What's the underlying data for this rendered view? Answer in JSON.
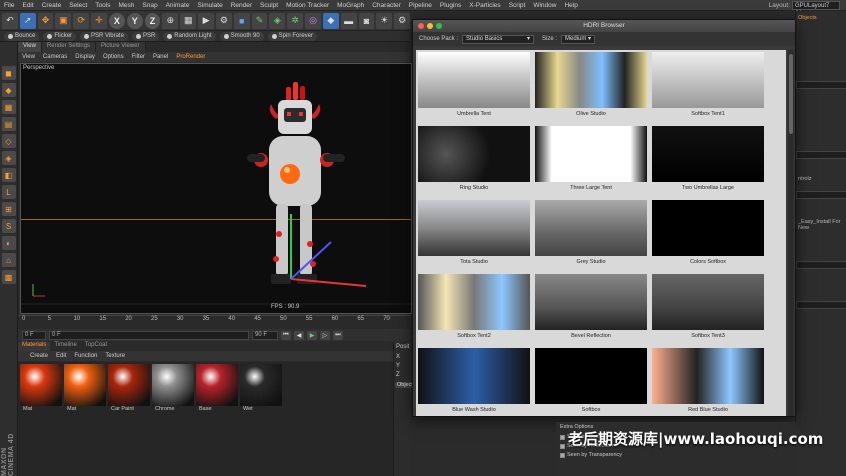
{
  "menu": {
    "items": [
      "File",
      "Edit",
      "Create",
      "Select",
      "Tools",
      "Mesh",
      "Snap",
      "Animate",
      "Simulate",
      "Render",
      "Sculpt",
      "Motion Tracker",
      "MoGraph",
      "Character",
      "Pipeline",
      "Plugins",
      "X-Particles",
      "Script",
      "Window",
      "Help"
    ],
    "layout_label": "Layout:",
    "layout_value": "GPULayout7 (User)"
  },
  "toolbar": {
    "icons": [
      "undo-icon",
      "select-icon",
      "move-icon",
      "scale-icon",
      "rotate-icon",
      "x-axis-icon",
      "y-axis-icon",
      "z-axis-icon",
      "coord-icon",
      "cube-icon",
      "pen-icon",
      "subdivide-icon",
      "array-icon",
      "deformer-icon",
      "floor-icon",
      "camera-icon",
      "light-icon",
      "tag-icon"
    ],
    "xyz": [
      "X",
      "Y",
      "Z"
    ]
  },
  "prorender_bar": {
    "buttons": [
      "Bounce",
      "Flicker",
      "PSR Vibrate",
      "PSR",
      "Random Light",
      "Smooth 90",
      "Spin Forever"
    ]
  },
  "viewport": {
    "tabs": [
      "View",
      "Render Settings",
      "Picture Viewer"
    ],
    "menu": [
      "View",
      "Cameras",
      "Display",
      "Options",
      "Filter",
      "Panel",
      "ProRender"
    ],
    "camera_label": "Perspective",
    "fps": "FPS : 90.9"
  },
  "timeline": {
    "ticks": [
      "0",
      "5",
      "10",
      "15",
      "20",
      "25",
      "30",
      "35",
      "40",
      "45",
      "50",
      "55",
      "60",
      "65",
      "70"
    ],
    "start_frame": "0 F",
    "current_frame": "0 F",
    "end_frame": "90 F",
    "max_frame": "90 F"
  },
  "materials": {
    "tabs": [
      "Materials",
      "Timeline",
      "TopCoat"
    ],
    "menu": [
      "Create",
      "Edit",
      "Function",
      "Texture"
    ],
    "items": [
      {
        "name": "Mat",
        "color": "#d9380e"
      },
      {
        "name": "Mat",
        "color": "#f06010"
      },
      {
        "name": "Car Paint",
        "color": "#a8260c"
      },
      {
        "name": "Chrome",
        "color": "#8f8f8f"
      },
      {
        "name": "Base",
        "color": "#b8222a"
      },
      {
        "name": "Wet",
        "color": "#2a2a2a"
      }
    ]
  },
  "coordinates": {
    "header": "Posit",
    "rows": [
      {
        "axis": "X",
        "value": "0 cm"
      },
      {
        "axis": "Y",
        "value": "0 cm"
      },
      {
        "axis": "Z",
        "value": "0 cm"
      }
    ],
    "mode": "Object"
  },
  "brand": "MAXON CINEMA 4D",
  "right_panel": {
    "tabs": [
      "Objects",
      "Takes",
      "Content Browser",
      "Structure"
    ],
    "texts": [
      "ntrolz",
      "_Easy_Install For New"
    ]
  },
  "hdri_browser": {
    "title": "HDRI Browser",
    "pack_label": "Choose Pack :",
    "pack_value": "Studio Basics",
    "size_label": "Size :",
    "size_value": "Medium",
    "items": [
      "Umbrella Tent",
      "Olive Studio",
      "Softbox Tent1",
      "Ring Studio",
      "Three Large Tent",
      "Two Umbrellas Large",
      "Tota Studio",
      "Grey Studio",
      "Colors Softbox",
      "Softbox Tent2",
      "Bevel Reflection",
      "Softbox Tent3",
      "Blue Wash Studio",
      "Softbox",
      "Red Blue Studio"
    ]
  },
  "render_extras": {
    "header": "Extra Options",
    "options": [
      "Seen by Camera",
      "Seen by Reflection",
      "Seen by Transparency"
    ]
  },
  "watermark": "老后期资源库|www.laohouqi.com",
  "colors": {
    "accent_orange": "#ff8c2a",
    "active_blue": "#3b6fb6",
    "panel_bg": "#2b2b2b"
  }
}
